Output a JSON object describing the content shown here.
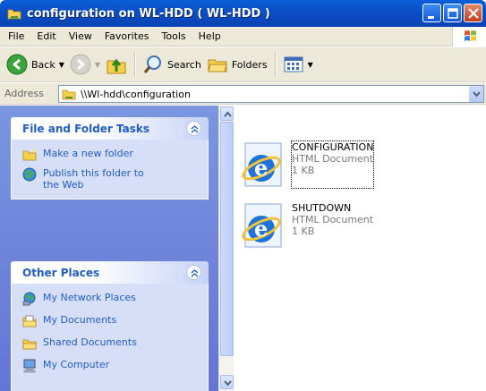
{
  "window": {
    "title": "configuration on WL-HDD ( WL-HDD )",
    "controls": [
      "minimize-icon",
      "maximize-icon",
      "close-icon"
    ]
  },
  "menubar": {
    "items": [
      "File",
      "Edit",
      "View",
      "Favorites",
      "Tools",
      "Help"
    ]
  },
  "toolbar": {
    "back_label": "Back",
    "search_label": "Search",
    "folders_label": "Folders",
    "icons": [
      "back-arrow-icon",
      "forward-arrow-icon",
      "up-folder-icon",
      "search-icon",
      "folders-icon",
      "views-icon"
    ]
  },
  "address": {
    "label": "Address",
    "value": "\\\\Wl-hdd\\configuration"
  },
  "taskpane": {
    "file_folder_tasks": {
      "title": "File and Folder Tasks",
      "items": [
        {
          "label": "Make a new folder",
          "icon": "new-folder-icon"
        },
        {
          "label": "Publish this folder to the Web",
          "icon": "publish-web-icon"
        }
      ]
    },
    "other_places": {
      "title": "Other Places",
      "items": [
        {
          "label": "My Network Places",
          "icon": "network-places-icon"
        },
        {
          "label": "My Documents",
          "icon": "my-documents-icon"
        },
        {
          "label": "Shared Documents",
          "icon": "shared-documents-icon"
        },
        {
          "label": "My Computer",
          "icon": "my-computer-icon"
        }
      ]
    }
  },
  "files": [
    {
      "name": "CONFIGURATION",
      "type": "HTML Document",
      "size": "1 KB",
      "icon": "ie-document-icon",
      "focused": true
    },
    {
      "name": "SHUTDOWN",
      "type": "HTML Document",
      "size": "1 KB",
      "icon": "ie-document-icon",
      "focused": false
    }
  ],
  "colors": {
    "titlebar": "#0b4ec6",
    "taskpane": "#6f85da",
    "panel_title": "#215dc6",
    "panel_body": "#d6dff7",
    "chrome": "#ece9d8"
  }
}
